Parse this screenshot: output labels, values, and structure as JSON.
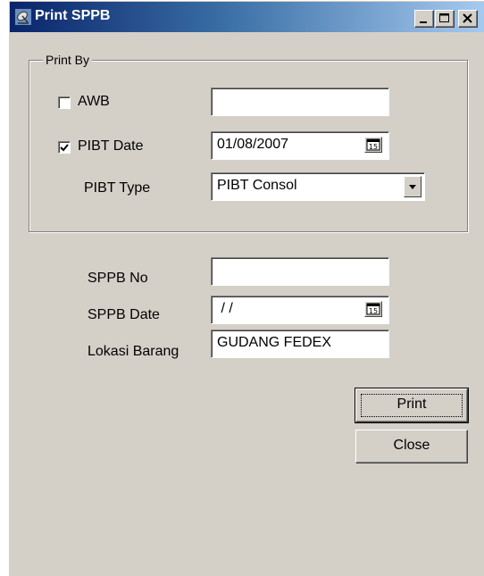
{
  "window": {
    "title": "Print SPPB"
  },
  "print_by": {
    "legend": "Print By",
    "awb": {
      "label": "AWB",
      "checked": false,
      "value": ""
    },
    "pibt_date": {
      "label": "PIBT Date",
      "checked": true,
      "value": "01/08/2007"
    },
    "pibt_type": {
      "label": "PIBT Type",
      "value": "PIBT Consol"
    }
  },
  "sppb": {
    "no_label": "SPPB No",
    "no_value": "",
    "date_label": "SPPB Date",
    "date_value": " / /",
    "lokasi_label": "Lokasi Barang",
    "lokasi_value": "GUDANG FEDEX"
  },
  "buttons": {
    "print": "Print",
    "close": "Close"
  },
  "icons": {
    "app": "satellite-dish-icon",
    "minimize": "minimize-icon",
    "maximize": "maximize-icon",
    "close": "close-icon",
    "calendar": "calendar-icon",
    "dropdown": "chevron-down-icon"
  },
  "colors": {
    "titlebar_start": "#0a246a",
    "titlebar_end": "#a6caf0",
    "face": "#d4d0c8"
  }
}
